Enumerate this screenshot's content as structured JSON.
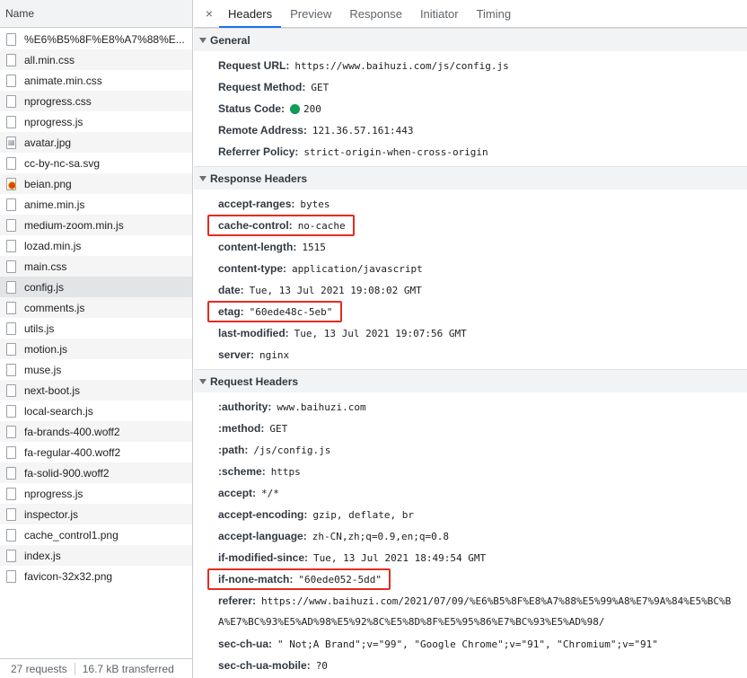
{
  "left": {
    "header": "Name",
    "files": [
      {
        "name": "%E6%B5%8F%E8%A7%88%E...",
        "icon": "doc-icon"
      },
      {
        "name": "all.min.css",
        "icon": "doc-icon"
      },
      {
        "name": "animate.min.css",
        "icon": "doc-icon"
      },
      {
        "name": "nprogress.css",
        "icon": "doc-icon"
      },
      {
        "name": "nprogress.js",
        "icon": "doc-icon"
      },
      {
        "name": "avatar.jpg",
        "icon": "image-icon"
      },
      {
        "name": "cc-by-nc-sa.svg",
        "icon": "doc-icon"
      },
      {
        "name": "beian.png",
        "icon": "badge-image-icon"
      },
      {
        "name": "anime.min.js",
        "icon": "doc-icon"
      },
      {
        "name": "medium-zoom.min.js",
        "icon": "doc-icon"
      },
      {
        "name": "lozad.min.js",
        "icon": "doc-icon"
      },
      {
        "name": "main.css",
        "icon": "doc-icon"
      },
      {
        "name": "config.js",
        "icon": "doc-icon",
        "selected": true
      },
      {
        "name": "comments.js",
        "icon": "doc-icon"
      },
      {
        "name": "utils.js",
        "icon": "doc-icon"
      },
      {
        "name": "motion.js",
        "icon": "doc-icon"
      },
      {
        "name": "muse.js",
        "icon": "doc-icon"
      },
      {
        "name": "next-boot.js",
        "icon": "doc-icon"
      },
      {
        "name": "local-search.js",
        "icon": "doc-icon"
      },
      {
        "name": "fa-brands-400.woff2",
        "icon": "doc-icon"
      },
      {
        "name": "fa-regular-400.woff2",
        "icon": "doc-icon"
      },
      {
        "name": "fa-solid-900.woff2",
        "icon": "doc-icon"
      },
      {
        "name": "nprogress.js",
        "icon": "doc-icon"
      },
      {
        "name": "inspector.js",
        "icon": "doc-icon"
      },
      {
        "name": "cache_control1.png",
        "icon": "doc-icon"
      },
      {
        "name": "index.js",
        "icon": "doc-icon"
      },
      {
        "name": "favicon-32x32.png",
        "icon": "doc-icon"
      }
    ],
    "status": {
      "requests": "27 requests",
      "transferred": "16.7 kB transferred"
    }
  },
  "tabs": {
    "close": "×",
    "items": [
      "Headers",
      "Preview",
      "Response",
      "Initiator",
      "Timing"
    ],
    "active": "Headers"
  },
  "general": {
    "title": "General",
    "rows": [
      {
        "key": "Request URL:",
        "value": "https://www.baihuzi.com/js/config.js"
      },
      {
        "key": "Request Method:",
        "value": "GET"
      },
      {
        "key": "Status Code:",
        "value": "200",
        "status_dot_color": "#0f9d58"
      },
      {
        "key": "Remote Address:",
        "value": "121.36.57.161:443"
      },
      {
        "key": "Referrer Policy:",
        "value": "strict-origin-when-cross-origin"
      }
    ]
  },
  "response_headers": {
    "title": "Response Headers",
    "rows": [
      {
        "key": "accept-ranges:",
        "value": "bytes"
      },
      {
        "key": "cache-control:",
        "value": "no-cache",
        "highlighted": true
      },
      {
        "key": "content-length:",
        "value": "1515"
      },
      {
        "key": "content-type:",
        "value": "application/javascript"
      },
      {
        "key": "date:",
        "value": "Tue, 13 Jul 2021 19:08:02 GMT"
      },
      {
        "key": "etag:",
        "value": "\"60ede48c-5eb\"",
        "highlighted": true
      },
      {
        "key": "last-modified:",
        "value": "Tue, 13 Jul 2021 19:07:56 GMT"
      },
      {
        "key": "server:",
        "value": "nginx"
      }
    ]
  },
  "request_headers": {
    "title": "Request Headers",
    "rows": [
      {
        "key": ":authority:",
        "value": "www.baihuzi.com"
      },
      {
        "key": ":method:",
        "value": "GET"
      },
      {
        "key": ":path:",
        "value": "/js/config.js"
      },
      {
        "key": ":scheme:",
        "value": "https"
      },
      {
        "key": "accept:",
        "value": "*/*"
      },
      {
        "key": "accept-encoding:",
        "value": "gzip, deflate, br"
      },
      {
        "key": "accept-language:",
        "value": "zh-CN,zh;q=0.9,en;q=0.8"
      },
      {
        "key": "if-modified-since:",
        "value": "Tue, 13 Jul 2021 18:49:54 GMT"
      },
      {
        "key": "if-none-match:",
        "value": "\"60ede052-5dd\"",
        "highlighted": true
      },
      {
        "key": "referer:",
        "value": "https://www.baihuzi.com/2021/07/09/%E6%B5%8F%E8%A7%88%E5%99%A8%E7%9A%84%E5%BC%BA%E7%BC%93%E5%AD%98%E5%92%8C%E5%8D%8F%E5%95%86%E7%BC%93%E5%AD%98/",
        "wrap": true
      },
      {
        "key": "sec-ch-ua:",
        "value": "\" Not;A Brand\";v=\"99\", \"Google Chrome\";v=\"91\", \"Chromium\";v=\"91\""
      },
      {
        "key": "sec-ch-ua-mobile:",
        "value": "?0"
      }
    ]
  },
  "colors": {
    "highlight": "#e52b22",
    "tab_active": "#1a73e8",
    "status_ok": "#0f9d58"
  }
}
